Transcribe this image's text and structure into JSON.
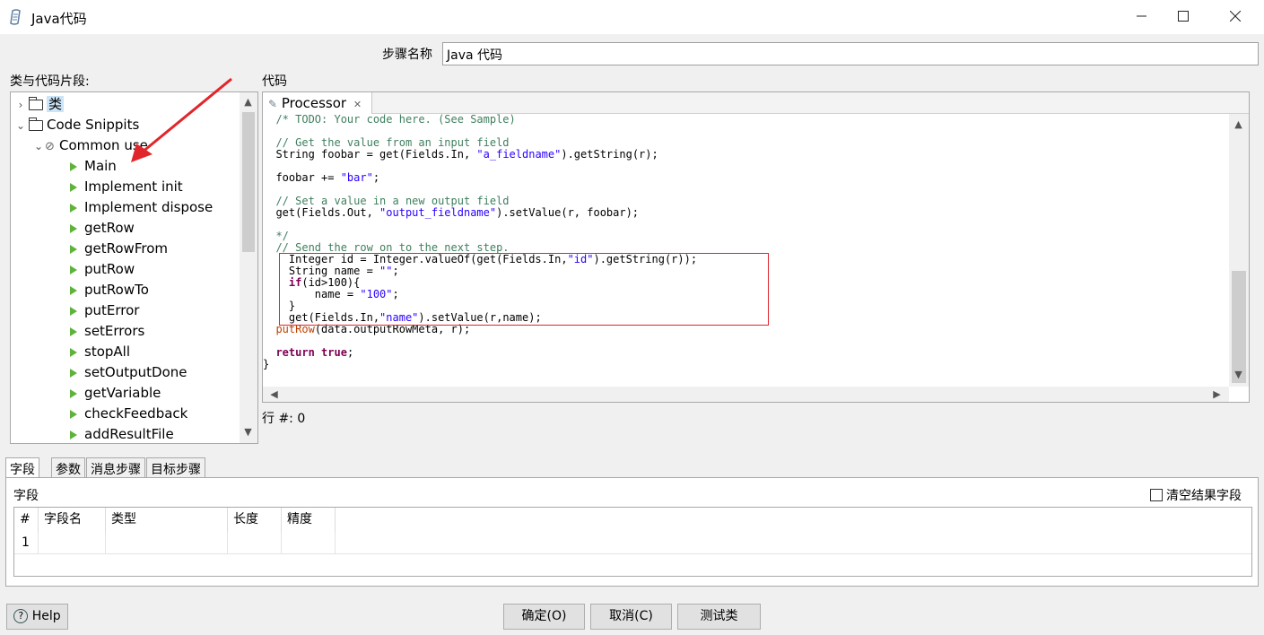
{
  "window": {
    "title": "Java代码",
    "icon": "script-icon",
    "controls": [
      "minimize",
      "maximize",
      "close"
    ]
  },
  "step": {
    "label": "步骤名称",
    "value": "Java 代码"
  },
  "left_panel": {
    "label": "类与代码片段:",
    "tree": [
      {
        "label": "类",
        "selected": true
      },
      {
        "label": "Code Snippits"
      },
      {
        "label": "Common use"
      },
      {
        "label": "Main"
      },
      {
        "label": "Implement init"
      },
      {
        "label": "Implement dispose"
      },
      {
        "label": "getRow"
      },
      {
        "label": "getRowFrom"
      },
      {
        "label": "putRow"
      },
      {
        "label": "putRowTo"
      },
      {
        "label": "putError"
      },
      {
        "label": "setErrors"
      },
      {
        "label": "stopAll"
      },
      {
        "label": "setOutputDone"
      },
      {
        "label": "getVariable"
      },
      {
        "label": "checkFeedback"
      },
      {
        "label": "addResultFile"
      }
    ]
  },
  "code_panel": {
    "label": "代码",
    "tab": "Processor",
    "lines": [
      "  /* TODO: Your code here. (See Sample)",
      "",
      "  // Get the value from an input field",
      "  String foobar = get(Fields.In, \"a_fieldname\").getString(r);",
      "",
      "  foobar += \"bar\";",
      "",
      "  // Set a value in a new output field",
      "  get(Fields.Out, \"output_fieldname\").setValue(r, foobar);",
      "",
      "  */",
      "  // Send the row on to the next step.",
      "    Integer id = Integer.valueOf(get(Fields.In,\"id\").getString(r));",
      "    String name = \"\";",
      "    if(id>100){",
      "        name = \"100\";",
      "    }",
      "    get(Fields.In,\"name\").setValue(r,name);",
      "  putRow(data.outputRowMeta, r);",
      "",
      "  return true;",
      "}"
    ],
    "row_status": "行 #: 0"
  },
  "bottom_tabs": {
    "tabs": [
      "字段",
      "参数",
      "消息步骤",
      "目标步骤"
    ],
    "active": "字段",
    "fields_label": "字段",
    "clear_label": "清空结果字段",
    "grid": {
      "columns": [
        "#",
        "字段名",
        "类型",
        "长度",
        "精度"
      ],
      "rows": [
        [
          "1",
          "",
          "",
          "",
          ""
        ]
      ]
    }
  },
  "buttons": {
    "help": "Help",
    "ok": "确定(O)",
    "cancel": "取消(C)",
    "test": "测试类"
  }
}
